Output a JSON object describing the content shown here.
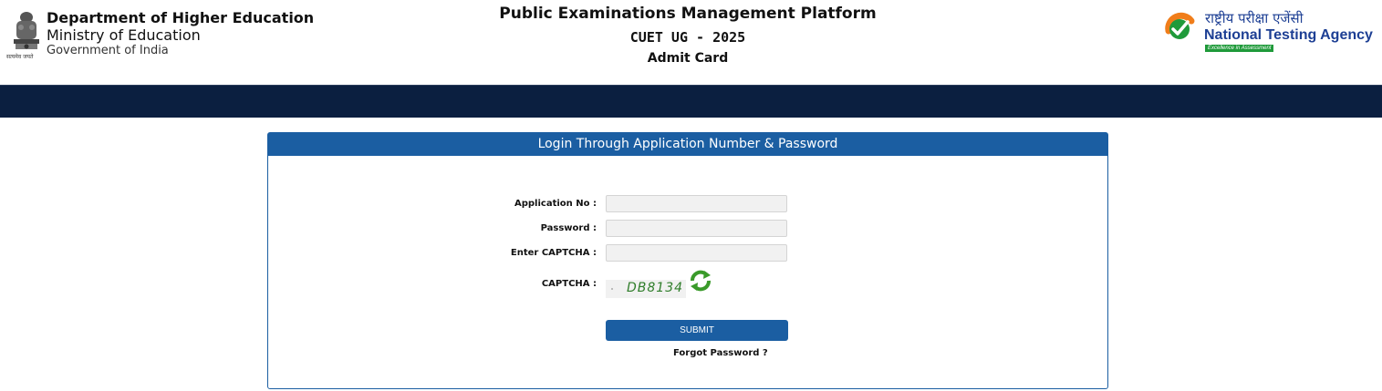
{
  "header": {
    "emblem_caption": "सत्यमेव जयते",
    "department": "Department of Higher Education",
    "ministry": "Ministry of Education",
    "government": "Government of India",
    "platform_title": "Public Examinations Management Platform",
    "exam_name": "CUET UG - 2025",
    "page_name": "Admit Card",
    "agency_hindi": "राष्ट्रीय परीक्षा एजेंसी",
    "agency_english": "National Testing Agency",
    "agency_tagline": "Excellence in Assessment"
  },
  "login": {
    "panel_title": "Login Through Application Number & Password",
    "fields": [
      {
        "label": "Application No :",
        "value": "",
        "placeholder": ""
      },
      {
        "label": "Password :",
        "value": "",
        "placeholder": ""
      },
      {
        "label": "Enter CAPTCHA :",
        "value": "",
        "placeholder": ""
      }
    ],
    "captcha_label": "CAPTCHA :",
    "captcha_text": "DB8134",
    "submit_label": "SUBMIT",
    "forgot_label": "Forgot Password ?"
  },
  "colors": {
    "nav_band": "#0b1f40",
    "panel_blue": "#1b5ea2",
    "captcha_green": "#2f7d2a",
    "agency_blue": "#1d3f94"
  },
  "icons": [
    "national-emblem-icon",
    "nta-logo-icon",
    "refresh-captcha-icon"
  ]
}
